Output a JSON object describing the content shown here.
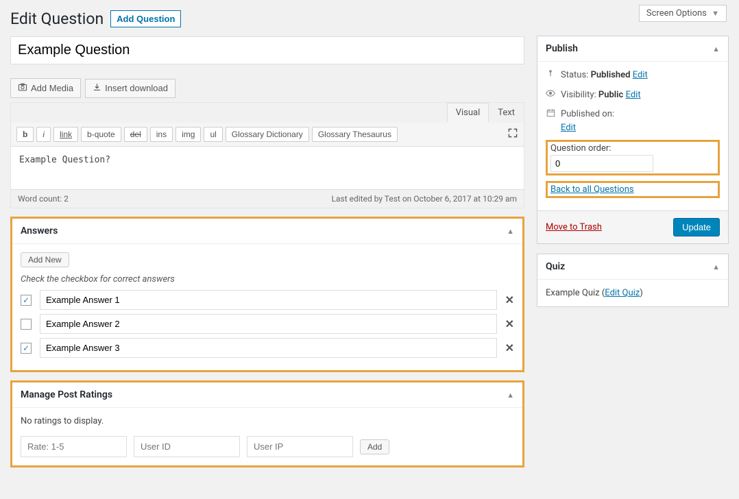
{
  "screen_options": "Screen Options",
  "page": {
    "title": "Edit Question",
    "add_button": "Add Question",
    "title_value": "Example Question"
  },
  "media": {
    "add_media": "Add Media",
    "insert_download": "Insert download"
  },
  "editor": {
    "tabs": {
      "visual": "Visual",
      "text": "Text"
    },
    "toolbar": {
      "b": "b",
      "i": "i",
      "link": "link",
      "bquote": "b-quote",
      "del": "del",
      "ins": "ins",
      "img": "img",
      "ul": "ul",
      "glossary_dict": "Glossary Dictionary",
      "glossary_thes": "Glossary Thesaurus"
    },
    "content": "Example Question?",
    "word_count_label": "Word count: 2",
    "last_edited": "Last edited by Test on October 6, 2017 at 10:29 am"
  },
  "answers": {
    "title": "Answers",
    "add_new": "Add New",
    "hint": "Check the checkbox for correct answers",
    "items": [
      {
        "value": "Example Answer 1",
        "checked": true
      },
      {
        "value": "Example Answer 2",
        "checked": false
      },
      {
        "value": "Example Answer 3",
        "checked": true
      }
    ]
  },
  "ratings": {
    "title": "Manage Post Ratings",
    "empty": "No ratings to display.",
    "rate_placeholder": "Rate: 1-5",
    "userid_placeholder": "User ID",
    "userip_placeholder": "User IP",
    "add": "Add"
  },
  "publish": {
    "title": "Publish",
    "status_label": "Status:",
    "status_value": "Published",
    "visibility_label": "Visibility:",
    "visibility_value": "Public",
    "published_on_label": "Published on:",
    "edit": "Edit",
    "order_label": "Question order:",
    "order_value": "0",
    "back_link": "Back to all Questions",
    "trash": "Move to Trash",
    "update": "Update"
  },
  "quiz": {
    "title": "Quiz",
    "name": "Example Quiz",
    "edit_link": "Edit Quiz"
  }
}
